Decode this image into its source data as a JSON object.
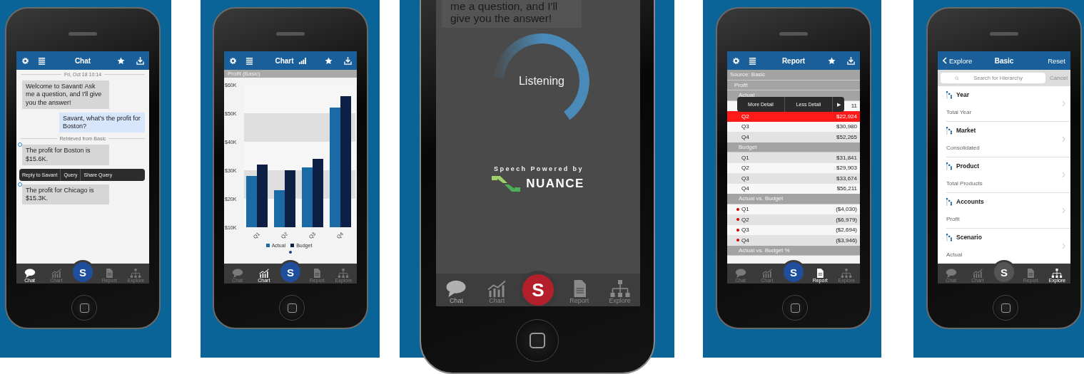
{
  "phones": [
    {
      "kind": "chat",
      "nav": {
        "title": "Chat"
      },
      "items": [
        {
          "kind": "divider",
          "text": "Fri, Oct 18 10:14"
        },
        {
          "kind": "bot",
          "text": "Welcome to Savant! Ask me a question, and I'll give you the answer!",
          "marked": false
        },
        {
          "kind": "user",
          "text": "Savant, what's the profit for Boston?"
        },
        {
          "kind": "divider",
          "text": "Retrieved from Basic"
        },
        {
          "kind": "bot",
          "text": "The profit for Boston is $15.6K.",
          "marked": true
        },
        {
          "kind": "menu",
          "options": [
            "Reply to Savant",
            "Query",
            "Share Query"
          ]
        },
        {
          "kind": "bot",
          "text": "The profit for Chicago is $15.3K.",
          "marked": true
        }
      ],
      "center_button": {
        "label": "S",
        "color": "#1f4f9c"
      },
      "tabs": [
        {
          "label": "Chat",
          "selected": true
        },
        {
          "label": "Chart",
          "selected": false
        },
        {
          "label": "Report",
          "selected": false
        },
        {
          "label": "Explore",
          "selected": false
        }
      ]
    },
    {
      "kind": "chart",
      "nav": {
        "title": "Chart"
      },
      "chart_data": {
        "type": "bar",
        "title": "Profit (Basic)",
        "categories": [
          "Q1",
          "Q2",
          "Q3",
          "Q4"
        ],
        "series": [
          {
            "name": "Actual",
            "color": "#1a6aa5",
            "values": [
              28000,
              23000,
              31000,
              52000
            ]
          },
          {
            "name": "Budget",
            "color": "#0d1f45",
            "values": [
              32000,
              30000,
              34000,
              56000
            ]
          }
        ],
        "ylim": [
          10000,
          60000
        ],
        "yticks": [
          {
            "value": 10000,
            "label": "$10K"
          },
          {
            "value": 20000,
            "label": "$20K"
          },
          {
            "value": 30000,
            "label": "$30K"
          },
          {
            "value": 40000,
            "label": "$40K"
          },
          {
            "value": 50000,
            "label": "$50K"
          },
          {
            "value": 60000,
            "label": "$60K"
          }
        ]
      },
      "center_button": {
        "label": "S",
        "color": "#1f4f9c"
      },
      "tabs": [
        {
          "label": "Chat",
          "selected": false
        },
        {
          "label": "Chart",
          "selected": true
        },
        {
          "label": "Report",
          "selected": false
        },
        {
          "label": "Explore",
          "selected": false
        }
      ]
    },
    {
      "kind": "listening",
      "bubble": "me a question, and I'll give you the answer!",
      "status": "Listening",
      "powered_by": "Speech Powered by",
      "brand": "NUANCE",
      "center_button": {
        "label": "S",
        "color": "#b3202b"
      },
      "tabs": [
        {
          "label": "Chat",
          "selected": true
        },
        {
          "label": "Chart",
          "selected": false
        },
        {
          "label": "Report",
          "selected": false
        },
        {
          "label": "Explore",
          "selected": false
        }
      ]
    },
    {
      "kind": "report",
      "nav": {
        "title": "Report"
      },
      "report": {
        "popup": [
          "More Detail",
          "Less Detail",
          "▶"
        ],
        "tree": [
          {
            "kind": "group",
            "label": "Source: Basic",
            "children": [
              {
                "kind": "group",
                "label": "Profit",
                "children": [
                  {
                    "kind": "group",
                    "label": "Actual",
                    "children": [
                      {
                        "kind": "row",
                        "value": "11",
                        "selected": false,
                        "flagged": false
                      },
                      {
                        "kind": "row",
                        "label": "Q2",
                        "value": "$22,924",
                        "selected": true,
                        "flagged": false
                      },
                      {
                        "kind": "row",
                        "label": "Q3",
                        "value": "$30,980",
                        "selected": false,
                        "flagged": false
                      },
                      {
                        "kind": "row",
                        "label": "Q4",
                        "value": "$52,265",
                        "selected": false,
                        "flagged": false
                      }
                    ]
                  },
                  {
                    "kind": "group",
                    "label": "Budget",
                    "children": [
                      {
                        "kind": "row",
                        "label": "Q1",
                        "value": "$31,841",
                        "selected": false,
                        "flagged": false
                      },
                      {
                        "kind": "row",
                        "label": "Q2",
                        "value": "$29,903",
                        "selected": false,
                        "flagged": false
                      },
                      {
                        "kind": "row",
                        "label": "Q3",
                        "value": "$33,674",
                        "selected": false,
                        "flagged": false
                      },
                      {
                        "kind": "row",
                        "label": "Q4",
                        "value": "$56,211",
                        "selected": false,
                        "flagged": false
                      }
                    ]
                  },
                  {
                    "kind": "group",
                    "label": "Actual vs. Budget",
                    "children": [
                      {
                        "kind": "row",
                        "label": "Q1",
                        "value": "($4,030)",
                        "selected": false,
                        "flagged": true
                      },
                      {
                        "kind": "row",
                        "label": "Q2",
                        "value": "($6,979)",
                        "selected": false,
                        "flagged": true
                      },
                      {
                        "kind": "row",
                        "label": "Q3",
                        "value": "($2,694)",
                        "selected": false,
                        "flagged": true
                      },
                      {
                        "kind": "row",
                        "label": "Q4",
                        "value": "($3,946)",
                        "selected": false,
                        "flagged": true
                      }
                    ]
                  },
                  {
                    "kind": "group",
                    "label": "Actual vs. Budget %"
                  }
                ]
              }
            ]
          }
        ]
      },
      "center_button": {
        "label": "S",
        "color": "#1f4f9c"
      },
      "tabs": [
        {
          "label": "Chat",
          "selected": false
        },
        {
          "label": "Chart",
          "selected": false
        },
        {
          "label": "Report",
          "selected": true
        },
        {
          "label": "Explore",
          "selected": false
        }
      ]
    },
    {
      "kind": "explore",
      "nav": {
        "back": "Explore",
        "title": "Basic",
        "action": "Reset"
      },
      "search": {
        "placeholder": "Search for Hierarchy"
      },
      "cancel": {
        "label": "Cancel",
        "disabled": true
      },
      "hierarchies": [
        {
          "name": "Year",
          "value": "Total Year"
        },
        {
          "name": "Market",
          "value": "Consolidated"
        },
        {
          "name": "Product",
          "value": "Total Products"
        },
        {
          "name": "Accounts",
          "value": "Profit"
        },
        {
          "name": "Scenario",
          "value": "Actual"
        }
      ],
      "center_button": {
        "label": "S",
        "color": "#555555"
      },
      "tabs": [
        {
          "label": "Chat",
          "selected": false
        },
        {
          "label": "Chart",
          "selected": false
        },
        {
          "label": "Report",
          "selected": false
        },
        {
          "label": "Explore",
          "selected": true
        }
      ]
    }
  ]
}
